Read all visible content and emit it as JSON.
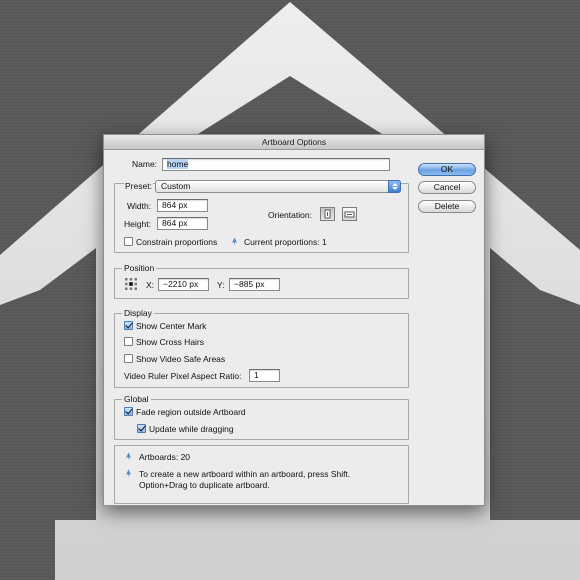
{
  "dialog": {
    "title": "Artboard Options",
    "name_label": "Name:",
    "name_value": "home",
    "buttons": {
      "ok": "OK",
      "cancel": "Cancel",
      "delete": "Delete"
    },
    "preset": {
      "label": "Preset:",
      "value": "Custom",
      "width_label": "Width:",
      "width_value": "864 px",
      "height_label": "Height:",
      "height_value": "864 px",
      "orientation_label": "Orientation:",
      "orientation_icons": [
        "portrait-icon",
        "landscape-icon"
      ],
      "constrain_label": "Constrain proportions",
      "constrain_checked": false,
      "current_proportions": "Current proportions: 1"
    },
    "position": {
      "title": "Position",
      "x_label": "X:",
      "x_value": "−2210 px",
      "y_label": "Y:",
      "y_value": "−885 px"
    },
    "display": {
      "title": "Display",
      "show_center_mark": {
        "label": "Show Center Mark",
        "checked": true
      },
      "show_cross_hairs": {
        "label": "Show Cross Hairs",
        "checked": false
      },
      "show_video_safe": {
        "label": "Show Video Safe Areas",
        "checked": false
      },
      "ruler_label": "Video Ruler Pixel Aspect Ratio:",
      "ruler_value": "1"
    },
    "global": {
      "title": "Global",
      "fade_region": {
        "label": "Fade region outside Artboard",
        "checked": true
      },
      "update_dragging": {
        "label": "Update while dragging",
        "checked": true
      }
    },
    "info": {
      "artboards": "Artboards: 20",
      "hint_line1": "To create a new artboard within an artboard, press Shift.",
      "hint_line2": "Option+Drag to duplicate artboard."
    }
  },
  "colors": {
    "background": "#5b5b5b",
    "house": "#dcdcdc",
    "dialog": "#ececec",
    "accent": "#6aa3e3"
  }
}
